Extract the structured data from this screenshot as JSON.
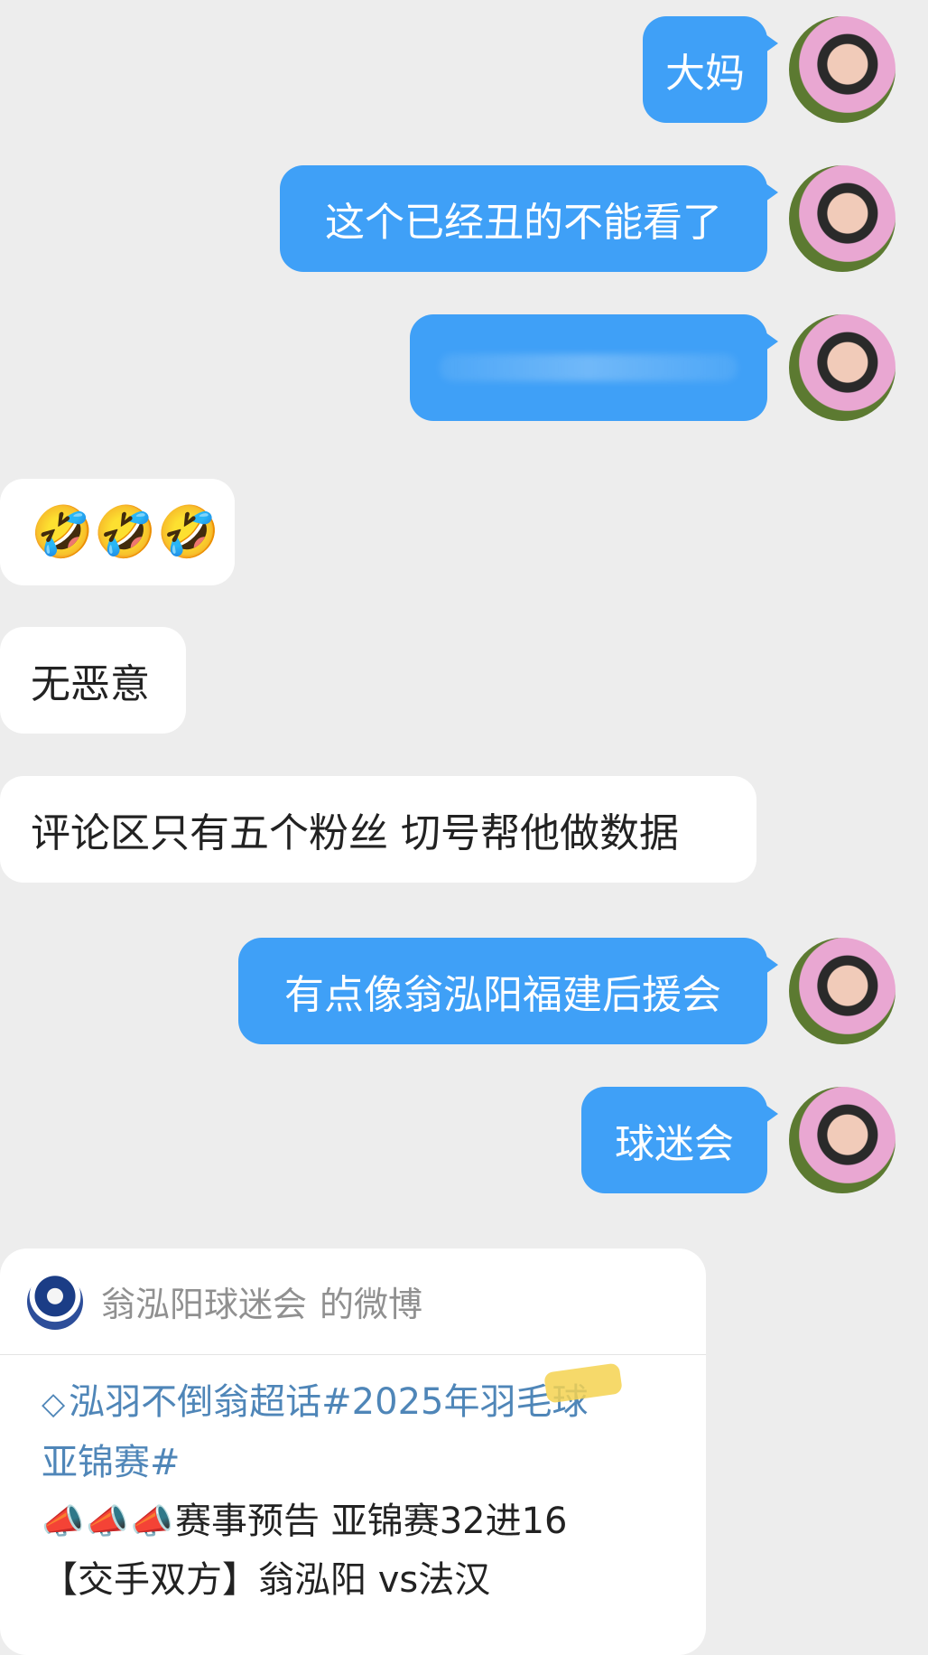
{
  "messages": {
    "m1": "大妈",
    "m2": "这个已经丑的不能看了",
    "m4": "🤣🤣🤣",
    "m5": "无恶意",
    "m6": "评论区只有五个粉丝 切号帮他做数据",
    "m7": "有点像翁泓阳福建后援会",
    "m8": "球迷会"
  },
  "card": {
    "account": "翁泓阳球迷会",
    "suffix": "的微博",
    "topic_line_1": "泓羽不倒翁超话#2025年羽毛球",
    "topic_line_2": "亚锦赛#",
    "line_3": "赛事预告 亚锦赛32进16",
    "line_4": "【交手双方】翁泓阳 vs法汉",
    "icons": {
      "diamond": "◇",
      "megaphone": "📣"
    }
  },
  "colors": {
    "outgoing_bubble": "#3fa0f7",
    "incoming_bubble": "#ffffff",
    "background": "#ededed",
    "topic_link": "#4f86b8"
  }
}
